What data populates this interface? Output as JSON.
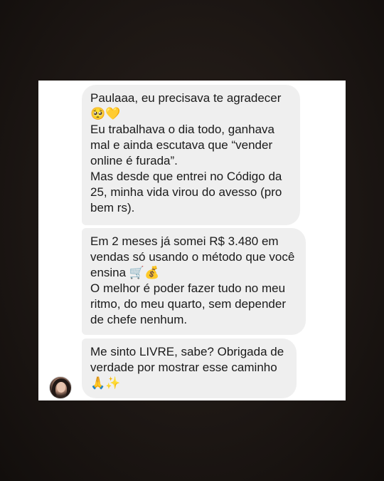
{
  "messages": [
    {
      "paragraphs": [
        "Paulaaa, eu precisava te agradecer 🥺💛",
        "Eu trabalhava o dia todo, ganhava mal e ainda escutava que “vender online é furada”.",
        "Mas desde que entrei no Código da 25, minha vida virou do avesso (pro bem rs)."
      ]
    },
    {
      "paragraphs": [
        "Em 2 meses já somei R$ 3.480 em vendas só usando o método que você ensina 🛒💰",
        "O melhor é poder fazer tudo no meu ritmo, do meu quarto, sem depender de chefe nenhum."
      ]
    },
    {
      "paragraphs": [
        "Me sinto LIVRE, sabe? Obrigada de verdade por mostrar esse caminho 🙏✨"
      ]
    }
  ],
  "colors": {
    "background": "#1d1714",
    "card": "#ffffff",
    "bubble": "#efefef",
    "text": "#1a1a1a"
  },
  "icons": {
    "avatar": "sender-avatar"
  }
}
